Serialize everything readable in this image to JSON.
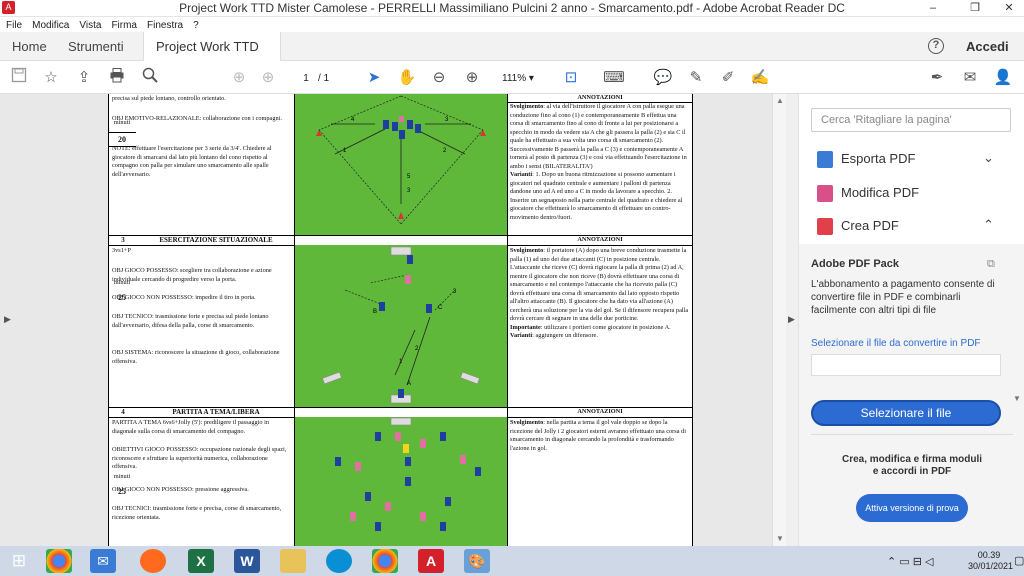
{
  "window": {
    "title": "Project Work TTD Mister Camolese - PERRELLI Massimiliano Pulcini 2 anno - Smarcamento.pdf - Adobe Acrobat Reader DC",
    "minimize": "–",
    "maximize": "❐",
    "close": "✕"
  },
  "menu": [
    "File",
    "Modifica",
    "Vista",
    "Firma",
    "Finestra",
    "?"
  ],
  "tabs": {
    "home": "Home",
    "tools": "Strumenti",
    "doc": "Project Work TTD ...",
    "close": "×",
    "help": "?",
    "login": "Accedi"
  },
  "toolbar": {
    "page_current": "1",
    "page_total": "/ 1",
    "zoom": "111%"
  },
  "document": {
    "row1": {
      "left_text1": "precisa sul piede lontano, controllo orientato.",
      "left_text2": "OBJ EMOTIVO-RELAZIONALE: collaborazione con i compagni.",
      "left_text3": "NOTE: effettuare l'esercitazione per 3 serie da 3/4'. Chiedere al giocatore di smarcarsi dal lato più lontano del cono rispetto al compagno con palla per simulare uno smarcamento alle spalle dell'avversario.",
      "minuti": "minuti",
      "minutes": "20",
      "ann_header": "ANNOTAZIONI",
      "svolg_label": "Svolgimento",
      "svolg": ": al via dell'istruttore il giocatore A con palla esegue una conduzione fino al cono (1) e contemporaneamente B effettua una corsa di smarcamento fino al cono di fronte a lui per posizionarsi a specchio in modo da vedere sia A che gli passera la palla (2) e sia C il quale ha effettuato a sua volta uno corsa di smarcamento (2). Successivamente B passerà la palla a C (3) e contemporaneamente A tornerà al posto di partenza (3) e così via effettuando l'esercitazione in ambo i sensi (BILATERALITA')",
      "varianti_label": "Varianti",
      "varianti": ": 1. Dopo un buona ritmizzazione si possono aumentare i giocatori nel quadrato centrale e aumentare i palloni di partenza dandone uno ad A ed uno a C in modo da lavorare a specchio. 2. Inserire un segnaposto nella parte centrale del quadrato e chiedere al giocatore che effettuerà lo smarcamento di effettuare un contro-movimento dentro/fuori."
    },
    "row2": {
      "num": "3",
      "title": "ESERCITAZIONE SITUAZIONALE",
      "sub": "3vs1+P",
      "obj1": "OBJ GIOCO POSSESSO: scegliere tra collaborazione e azione individuale cercando di progredire verso la porta.",
      "obj2": "OBJ GIOCO NON POSSESSO: impedire il tiro in porta.",
      "obj3": "OBJ TECNICO: trasmissione forte e precisa sul piede lontano dall'avversario, difesa della palla, corse di smarcamento.",
      "obj4": "OBJ SISTEMA: riconoscere la situazione di gioco, collaborazione offensiva.",
      "minuti": "minuti",
      "minutes": "25",
      "ann_header": "ANNOTAZIONI",
      "svolg_label": "Svolgimento",
      "svolg": ": il portatore (A) dopo una breve conduzione trasmette la palla (1) ad uno dei due attaccanti (C) in posizione centrale. L'attaccante che riceve (C) dovrà rigiocare la palla di prima (2) ad A, mentre il giocatore che non riceve (B) dovrà effettuare una corsa di smarcamento e nel contempo l'attaccante che ha ricevuto palla (C) dovrà effettuare una corsa di smarcamento dal lato opposto rispetto all'altro attaccante (B). Il giocatore che ha dato via all'azione (A) cercherà una soluzione per la via del gol. Se il difensore recupera palla dovrà cercare di segnare in una delle due porticine.",
      "imp_label": "Importante",
      "imp": ": utilizzare i portieri come giocatore in posizione A.",
      "var_label": "Varianti",
      "var": ": aggiungere un difensore."
    },
    "row3": {
      "num": "4",
      "title": "PARTITA A TEMA/LIBERA",
      "obj1": "PARTITA A TEMA 6vs6+Jolly (5'): prediligere il passaggio in diagonale sulla corsa di smarcamento del compagno.",
      "obj2": "OBIETTIVI GIOCO POSSESSO: occupazione razionale degli spazi, riconoscere e sfruttare la superiorità numerica, collaborazione offensiva.",
      "obj3": "OBJ GIOCO NON POSSESSO: pressione aggressiva.",
      "obj4": "OBJ TECNICI: trasmissione forte e precisa, corse di smarcamento, ricezione orientata.",
      "minuti": "minuti",
      "minutes": "25",
      "ann_header": "ANNOTAZIONI",
      "svolg_label": "Svolgimento",
      "svolg": ": nella partita a tema il gol vale doppio se dopo la ricezione del Jolly i 2 giocatori esterni avranno effettuato una corsa di smarcamento in diagonale cercando la profondità e trasformando l'azione in gol."
    }
  },
  "panel": {
    "search_placeholder": "Cerca 'Ritagliare la pagina'",
    "items": [
      "Esporta PDF",
      "Modifica PDF",
      "Crea PDF"
    ],
    "pack_title": "Adobe PDF Pack",
    "pack_desc": "L'abbonamento a pagamento consente di convertire file in PDF e combinarli facilmente con altri tipi di file",
    "select_link": "Selezionare il file da convertire in PDF",
    "select_button": "Selezionare il file",
    "promo": "Crea, modifica e firma moduli e accordi in PDF",
    "trial_button": "Attiva versione di prova"
  },
  "taskbar": {
    "time": "00.39",
    "date": "30/01/2021"
  }
}
